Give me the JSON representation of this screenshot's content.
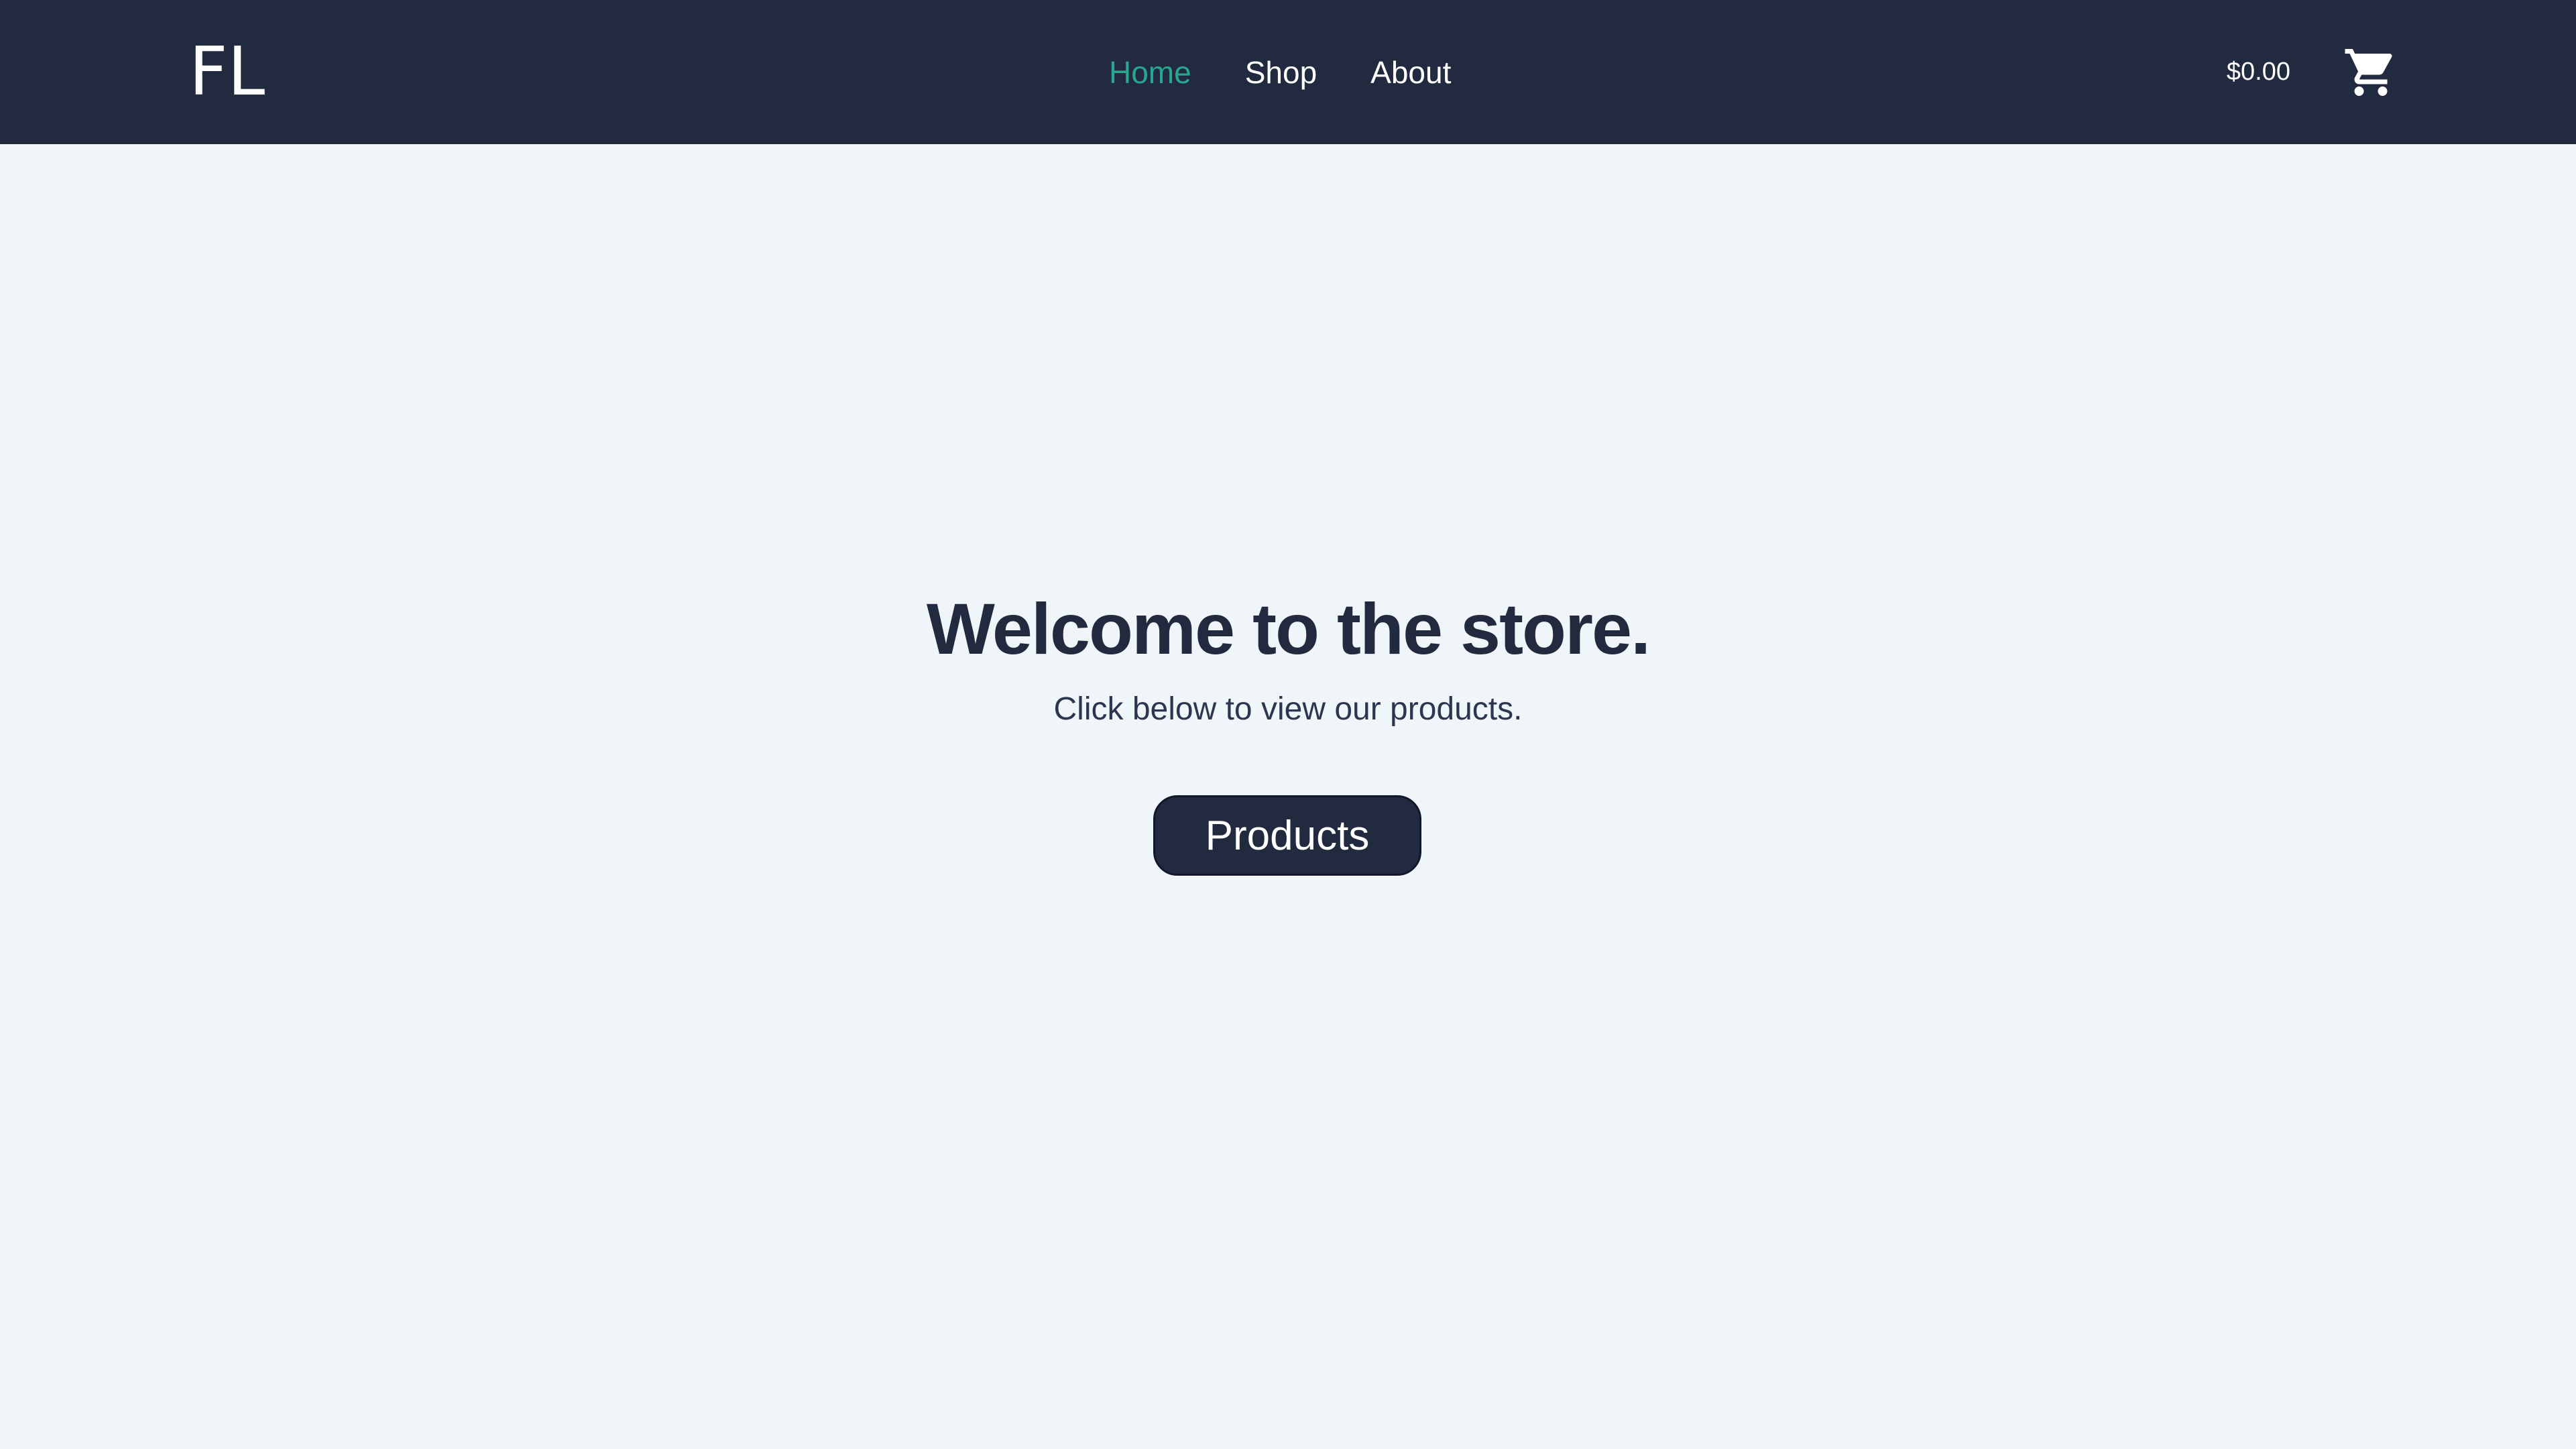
{
  "brand": {
    "logo": "FL"
  },
  "nav": {
    "items": [
      {
        "label": "Home",
        "active": true
      },
      {
        "label": "Shop",
        "active": false
      },
      {
        "label": "About",
        "active": false
      }
    ]
  },
  "cart": {
    "total": "$0.00",
    "icon": "shopping-cart-icon"
  },
  "hero": {
    "title": "Welcome to the store.",
    "subtitle": "Click below to view our products.",
    "button_label": "Products"
  },
  "colors": {
    "navbar_bg": "#222a3f",
    "page_bg": "#eff5f8",
    "active_link": "#2aa58f",
    "text_dark": "#222a3f",
    "button_bg": "#222a3f"
  }
}
